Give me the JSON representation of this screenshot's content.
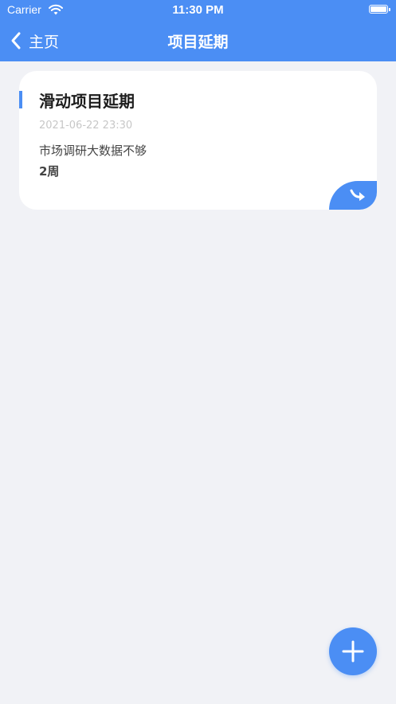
{
  "status_bar": {
    "carrier": "Carrier",
    "time": "11:30 PM"
  },
  "nav": {
    "back_label": "主页",
    "title": "项目延期"
  },
  "card": {
    "title": "滑动项目延期",
    "date": "2021-06-22 23:30",
    "reason": "市场调研大数据不够",
    "duration": "2周"
  },
  "icons": {
    "back": "chevron-left-icon",
    "share": "share-arrow-icon",
    "add": "plus-icon",
    "wifi": "wifi-icon",
    "battery": "battery-icon"
  },
  "colors": {
    "primary": "#4b8ef4",
    "background": "#f1f2f6",
    "card": "#ffffff"
  }
}
